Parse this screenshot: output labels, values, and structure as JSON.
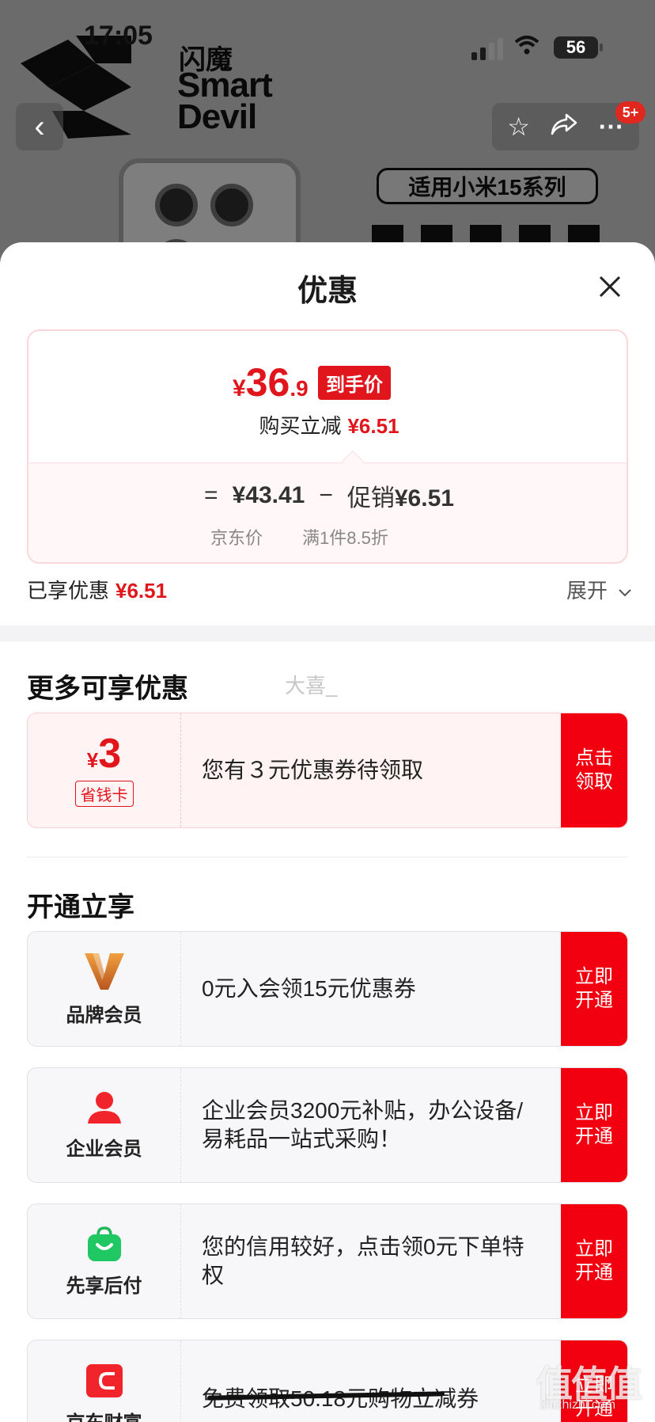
{
  "status_bar": {
    "time": "17:05",
    "battery": "56"
  },
  "background": {
    "brand_cn": "闪魔",
    "brand_en": "Smart Devil",
    "compat_label": "适用小米15系列"
  },
  "top_bar": {
    "badge": "5+",
    "icons": [
      "back-arrow-icon",
      "star-icon",
      "share-icon",
      "more-icon"
    ]
  },
  "sheet": {
    "title": "优惠",
    "price": {
      "symbol": "¥",
      "integer": "36",
      "decimal": ".9",
      "tag": "到手价",
      "instant_cut_label": "购买立减",
      "instant_cut_amount": "¥6.51"
    },
    "formula": {
      "eq": "=",
      "jd_price": "¥43.41",
      "minus": "−",
      "promo_label": "促销",
      "promo_amount": "¥6.51",
      "jd_price_label": "京东价",
      "promo_rule": "满1件8.5折"
    },
    "enjoyed": {
      "label": "已享优惠",
      "amount": "¥6.51",
      "expand_label": "展开"
    }
  },
  "more_offers": {
    "title": "更多可享优惠",
    "ghost_text": "大喜_",
    "coupon": {
      "symbol": "¥",
      "value": "3",
      "tag": "省钱卡",
      "text": "您有３元优惠券待领取",
      "button": "点击领取"
    }
  },
  "open_section": {
    "title": "开通立享",
    "items": [
      {
        "label": "品牌会员",
        "icon": "brand-v-icon",
        "text": "0元入会领15元优惠券",
        "button": "立即开通"
      },
      {
        "label": "企业会员",
        "icon": "user-icon",
        "text": "企业会员3200元补贴，办公设备/易耗品一站式采购！",
        "button": "立即开通"
      },
      {
        "label": "先享后付",
        "icon": "shopping-bag-icon",
        "text": "您的信用较好，点击领0元下单特权",
        "button": "立即开通"
      },
      {
        "label": "京东财富",
        "icon": "wallet-icon",
        "text": "免费领取50.18元购物立减券",
        "button": "立即开通"
      }
    ]
  },
  "watermark": {
    "main": "值值值",
    "sub": "zhizhizhi.com"
  },
  "colors": {
    "accent": "#e1151c",
    "button": "#f2000f"
  }
}
